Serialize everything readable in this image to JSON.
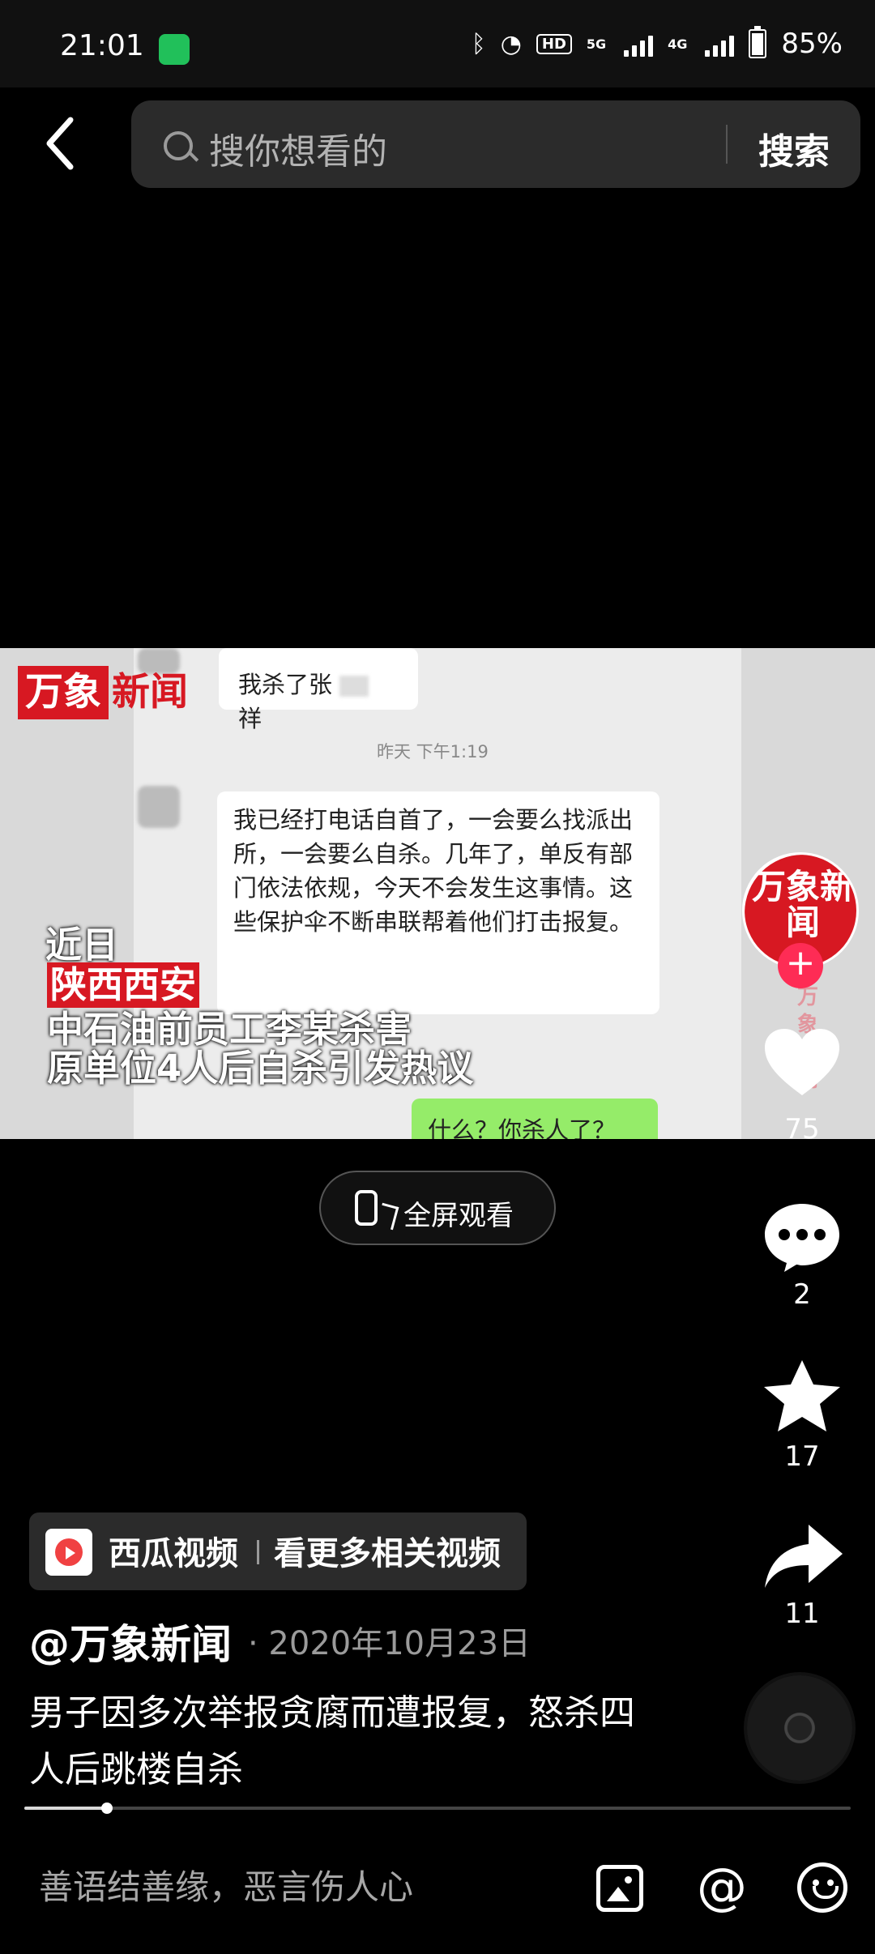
{
  "status_bar": {
    "time": "21:01",
    "hd_label": "HD",
    "network_5g": "5G",
    "network_4g": "4G",
    "battery": "85%"
  },
  "search": {
    "placeholder": "搜你想看的",
    "button_label": "搜索"
  },
  "video": {
    "logo_left": "万象",
    "logo_right": "新闻",
    "chat_top": "我杀了张",
    "chat_top_suffix": "祥",
    "chat_time": "昨天 下午1:19",
    "chat_main": "我已经打电话自首了，一会要么找派出所，一会要么自杀。几年了，单反有部门依法依规，今天不会发生这事情。这些保护伞不断串联帮着他们打击报复。",
    "chat_green": "什么？你杀人了？",
    "caption_1": "近日",
    "caption_2": "陕西西安",
    "caption_3": "中石油前员工李某杀害",
    "caption_4": "原单位4人后自杀引发热议",
    "watermark": "万象新闻"
  },
  "fullscreen": {
    "label": "全屏观看"
  },
  "account": {
    "avatar_text": "万象新闻",
    "follow_symbol": "+"
  },
  "rail": {
    "like_count": "75",
    "comment_count": "2",
    "favorite_count": "17",
    "share_count": "11"
  },
  "source": {
    "app_name": "西瓜视频",
    "link_text": "看更多相关视频"
  },
  "post": {
    "author": "@万象新闻",
    "date": "· 2020年10月23日",
    "description_line_1": "男子因多次举报贪腐而遭报复，怒杀四",
    "description_line_2": "人后跳楼自杀",
    "progress": 0.1
  },
  "comment_bar": {
    "placeholder": "善语结善缘，恶言伤人心",
    "at_symbol": "@"
  },
  "colors": {
    "accent_red": "#d71822",
    "follow_pink": "#fe2c55",
    "call_green": "#21c05a"
  },
  "icons": {
    "back": "chevron-left-icon",
    "search": "search-icon",
    "fullscreen": "phone-rotate-icon",
    "like": "heart-icon",
    "comment": "comment-bubble-icon",
    "favorite": "star-icon",
    "share": "share-arrow-icon",
    "music": "music-disc-icon",
    "image": "image-icon",
    "mention": "at-icon",
    "emoji": "emoji-icon"
  }
}
